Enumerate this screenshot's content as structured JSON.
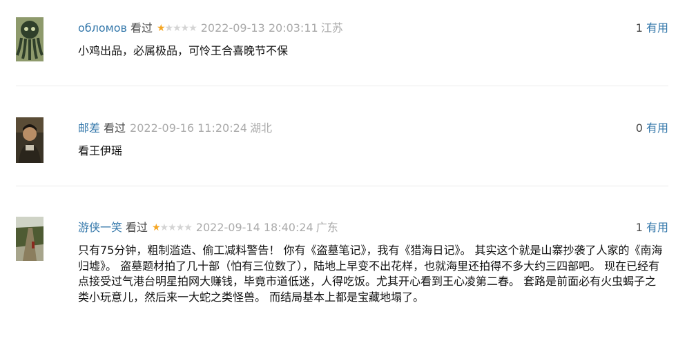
{
  "comments": [
    {
      "author": "обломов",
      "watched_label": "看过",
      "rating": 1,
      "time": "2022-09-13 20:03:11",
      "location": "江苏",
      "votes": "1",
      "vote_label": "有用",
      "text": "小鸡出品，必属极品，可怜王合喜晚节不保"
    },
    {
      "author": "邮差",
      "watched_label": "看过",
      "time": "2022-09-16 11:20:24",
      "location": "湖北",
      "votes": "0",
      "vote_label": "有用",
      "text": "看王伊瑶"
    },
    {
      "author": "游侠一笑",
      "watched_label": "看过",
      "rating": 1,
      "time": "2022-09-14 18:40:24",
      "location": "广东",
      "votes": "1",
      "vote_label": "有用",
      "text": "只有75分钟，粗制滥造、偷工减料警告！ 你有《盗墓笔记》，我有《猎海日记》。 其实这个就是山寨抄袭了人家的《南海归墟》。 盗墓题材拍了几十部（怕有三位数了），陆地上早变不出花样，也就海里还拍得不多大约三四部吧。 现在已经有点接受过气港台明星拍网大赚钱，毕竟市道低迷，人得吃饭。尤其开心看到王心凌第二春。 套路是前面必有火虫蝎子之类小玩意儿，然后来一大蛇之类怪兽。 而结局基本上都是宝藏地塌了。"
    }
  ]
}
